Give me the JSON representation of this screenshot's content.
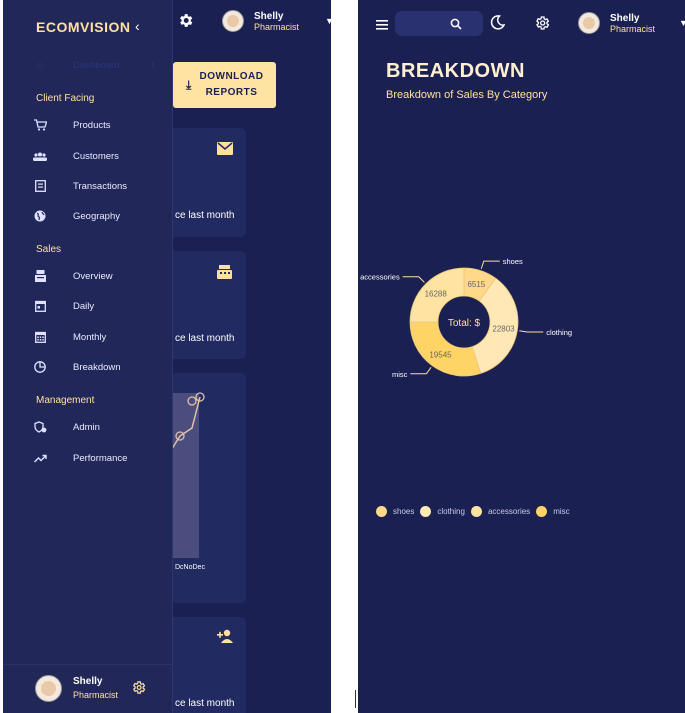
{
  "left_window": {
    "brand": "ECOMVISION",
    "brand_chevron": "‹",
    "topbar": {
      "settings_icon": "gear-icon",
      "user": {
        "name": "Shelly",
        "role": "Pharmacist"
      }
    },
    "sidebar": {
      "dashboard_label": "Dashboard",
      "sections": [
        {
          "title": "Client Facing",
          "items": [
            {
              "label": "Products",
              "icon": "cart-icon"
            },
            {
              "label": "Customers",
              "icon": "groups-icon"
            },
            {
              "label": "Transactions",
              "icon": "receipt-icon"
            },
            {
              "label": "Geography",
              "icon": "globe-icon"
            }
          ]
        },
        {
          "title": "Sales",
          "items": [
            {
              "label": "Overview",
              "icon": "point-of-sale-icon"
            },
            {
              "label": "Daily",
              "icon": "calendar-today-icon"
            },
            {
              "label": "Monthly",
              "icon": "calendar-month-icon"
            },
            {
              "label": "Breakdown",
              "icon": "pie-chart-icon"
            }
          ]
        },
        {
          "title": "Management",
          "items": [
            {
              "label": "Admin",
              "icon": "admin-icon"
            },
            {
              "label": "Performance",
              "icon": "trending-up-icon"
            }
          ]
        }
      ],
      "footer_user": {
        "name": "Shelly",
        "role": "Pharmacist"
      }
    },
    "download_button": {
      "line1": "DOWNLOAD",
      "line2": "REPORTS"
    },
    "cards": [
      {
        "text": "ce last month",
        "icon": "email-icon"
      },
      {
        "text": "ce last month",
        "icon": "point-of-sale-icon"
      },
      {
        "text": "ce last month",
        "icon": "person-add-icon"
      }
    ],
    "mini_chart_axis": "DcNoDec"
  },
  "right_window": {
    "topbar": {
      "menu_icon": "menu-icon",
      "search_icon": "search-icon",
      "theme_icon": "moon-icon",
      "settings_icon": "gear-icon",
      "user": {
        "name": "Shelly",
        "role": "Pharmacist"
      }
    },
    "title": "BREAKDOWN",
    "subtitle": "Breakdown of Sales By Category",
    "center_label": "Total: $",
    "legend": [
      "shoes",
      "clothing",
      "accessories",
      "misc"
    ]
  },
  "chart_data": {
    "type": "pie",
    "title": "",
    "categories": [
      "shoes",
      "clothing",
      "accessories",
      "misc"
    ],
    "values": [
      6515,
      22803,
      16288,
      19545
    ],
    "colors": [
      "#ffd889",
      "#ffe8b5",
      "#ffe3a3",
      "#ffd466"
    ]
  }
}
